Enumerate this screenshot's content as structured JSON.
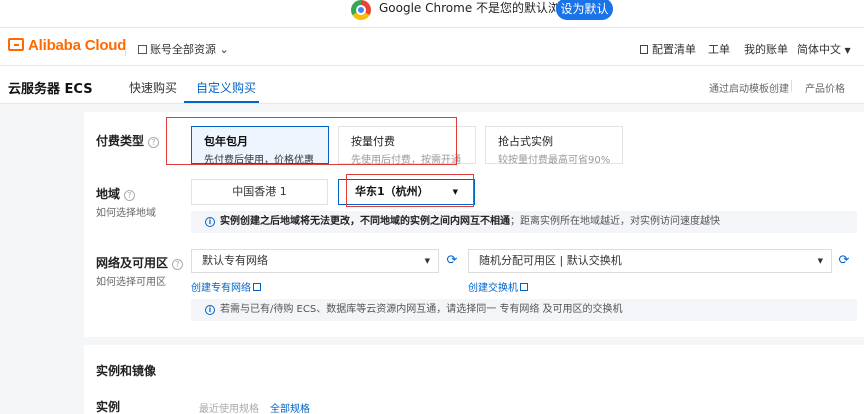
{
  "infobar": {
    "message": "Google Chrome 不是您的默认浏览器",
    "set_default_label": "设为默认"
  },
  "topnav": {
    "logo": "Alibaba Cloud",
    "account_resources": "账号全部资源",
    "config_list": "配置清单",
    "ticket": "工单",
    "my_account": "我的账单",
    "language": "简体中文"
  },
  "product": {
    "title": "云服务器 ECS",
    "tabs": [
      {
        "label": "快速购买",
        "active": false
      },
      {
        "label": "自定义购买",
        "active": true
      }
    ],
    "launch_template": "通过启动模板创建",
    "product_price": "产品价格"
  },
  "billing": {
    "label": "付费类型",
    "options": [
      {
        "title": "包年包月",
        "desc": "先付费后使用，价格优惠",
        "selected": true
      },
      {
        "title": "按量付费",
        "desc": "先使用后付费，按需开通",
        "selected": false
      },
      {
        "title": "抢占式实例",
        "desc": "较按量付费最高可省90%",
        "selected": false
      }
    ]
  },
  "region": {
    "label": "地域",
    "sublabel": "如何选择地域",
    "options": [
      {
        "label": "中国香港 1",
        "selected": false
      },
      {
        "label": "华东1（杭州）",
        "selected": true
      }
    ],
    "notice_bold": "实例创建之后地域将无法更改，不同地域的实例之间内网互不相通",
    "notice_rest": "；距离实例所在地域越近，对实例访问速度越快"
  },
  "network": {
    "label": "网络及可用区",
    "sublabel": "如何选择可用区",
    "vpc_value": "默认专有网络",
    "zone_value": "随机分配可用区 | 默认交换机",
    "create_vpc": "创建专有网络",
    "create_switch": "创建交换机",
    "notice": "若需与已有/待购 ECS、数据库等云资源内网互通，请选择同一 专有网络 及可用区的交换机"
  },
  "instance": {
    "section_title": "实例和镜像",
    "label": "实例",
    "recent": "最近使用规格",
    "all": "全部规格"
  },
  "colors": {
    "accent": "#0064c8",
    "brand": "#ff6a00",
    "highlight_box": "#e03c3c"
  }
}
